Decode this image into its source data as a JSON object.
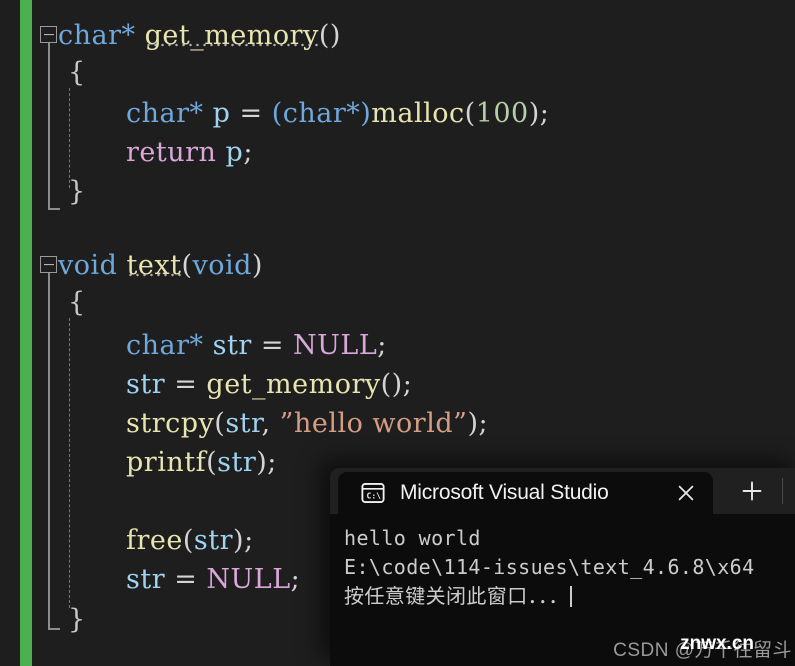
{
  "editor": {
    "background": "#1e1e1e",
    "change_bar_color": "#4caf50",
    "lines": [
      {
        "id": "l1",
        "text": "char* get_memory()"
      },
      {
        "id": "l2",
        "text": "{"
      },
      {
        "id": "l3",
        "text": "char* p = (char*)malloc(100);"
      },
      {
        "id": "l4",
        "text": "return p;"
      },
      {
        "id": "l5",
        "text": "}"
      },
      {
        "id": "l6",
        "text": "void text(void)"
      },
      {
        "id": "l7",
        "text": "{"
      },
      {
        "id": "l8",
        "text": "char* str = NULL;"
      },
      {
        "id": "l9",
        "text": "str = get_memory();"
      },
      {
        "id": "l10",
        "text": "strcpy(str, \"hello world\");"
      },
      {
        "id": "l11",
        "text": "printf(str);"
      },
      {
        "id": "l12",
        "text": "free(str);"
      },
      {
        "id": "l13",
        "text": "str = NULL;"
      },
      {
        "id": "l14",
        "text": "}"
      }
    ],
    "tokens": {
      "kw_char": "char*",
      "kw_void": "void",
      "fn_get_memory": "get_memory",
      "fn_malloc": "malloc",
      "fn_strcpy": "strcpy",
      "fn_printf": "printf",
      "fn_free": "free",
      "fn_text": "text",
      "kw_return": "return",
      "kw_null": "NULL",
      "var_p": "p",
      "var_str": "str",
      "num_100": "100",
      "str_hello": "\"hello world\"",
      "paren_open": "(",
      "paren_close": ")",
      "paren_empty": "()",
      "semi": ";",
      "comma": ",",
      "eq": "=",
      "cast_char": "(char*)",
      "brace_open": "{",
      "brace_close": "}",
      "space": " "
    },
    "colors": {
      "keyword": "#6fa8dc",
      "function": "#e8e4b0",
      "variable": "#9fd3f0",
      "control": "#d9a7d9",
      "string": "#d69d85",
      "number": "#b5cea8",
      "plain": "#dcdcdc"
    }
  },
  "terminal": {
    "tab_title": "Microsoft Visual Studio",
    "tab_icon": "command-prompt-icon",
    "close_label": "×",
    "newtab_label": "+",
    "dropdown_label": "∨",
    "output": [
      "hello world",
      "E:\\code\\114-issues\\text_4.6.8\\x64",
      "按任意键关闭此窗口．．．"
    ],
    "background": "#0c0c0c",
    "chrome_background": "#202020"
  },
  "watermark": {
    "base": "CSDN @万千往留斗",
    "overlay": "znwx.cn"
  }
}
